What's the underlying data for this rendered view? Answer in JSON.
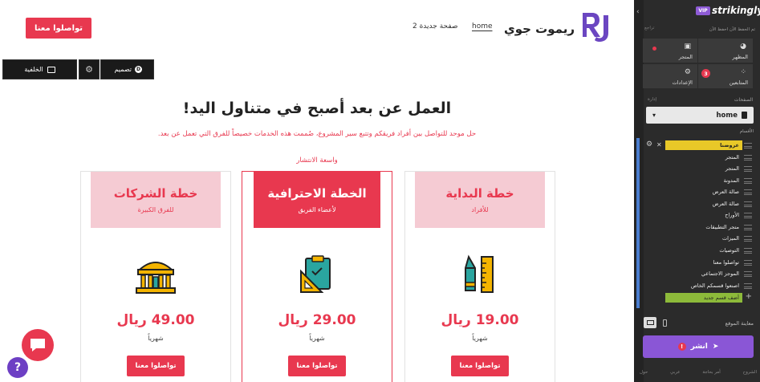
{
  "site": {
    "top_cta": "تواصلوا معنا",
    "brand": "ريموت جوي",
    "nav": {
      "home": "home",
      "new_page": "صفحة جديدة 2"
    },
    "toolbar": {
      "background": "الخلفية",
      "design": "تصميم",
      "design_mark": "D"
    },
    "headline": "العمل عن بعد أصبح في متناول اليد!",
    "subtext": "حل موحد للتواصل بين أفراد فريقكم وتتبع سير المشروع، صُممت هذه الخدمات خصيصاً للفرق التي تعمل عن بعد.",
    "popular_label": "واسعة الانتشار",
    "cards": [
      {
        "title": "خطة الشركات",
        "subtitle": "للفرق الكبيرة",
        "price": "49.00 ريال",
        "period": "شهرياً",
        "cta": "تواصلوا معنا",
        "icon": "bank-building-icon"
      },
      {
        "title": "الخطة الاحترافية",
        "subtitle": "لأعضاء الفريق",
        "price": "29.00 ريال",
        "period": "شهرياً",
        "cta": "تواصلوا معنا",
        "icon": "clipboard-ruler-icon"
      },
      {
        "title": "خطة البداية",
        "subtitle": "للأفراد",
        "price": "19.00 ريال",
        "period": "شهرياً",
        "cta": "تواصلوا معنا",
        "icon": "pen-ruler-icon"
      }
    ],
    "help_label": "?"
  },
  "editor": {
    "brand": "strikingly",
    "vip": "VIP",
    "saved_text": "تم الحفظ الآن احفظ الآن",
    "undo_text": "تراجع",
    "tiles": {
      "appearance": "المظهر",
      "store": "المتجر",
      "followers": "المتابعين",
      "settings": "الإعدادات"
    },
    "followers_count": "3",
    "pages_label": "الصفحات",
    "manage_label": "إدارة",
    "current_page": "home",
    "sections_label": "الأقسام",
    "sections": [
      "عروضنا",
      "المتجر",
      "المتجر",
      "المدونة",
      "صالة العرض",
      "صالة العرض",
      "الأوراح",
      "متجر التطبيقات",
      "الميزات",
      "التوصيات",
      "تواصلوا معنا",
      "الموجز الاجتماعي",
      "اصنعوا قسمكم الخاص"
    ],
    "add_section": "أضف قسم جديد",
    "preview_label": "معاينة الموقع",
    "publish_label": "انشر",
    "footer_links": [
      "الشروح",
      "أمر بحاجة",
      "عربي",
      "حول"
    ],
    "colors": {
      "accent": "#e8384f",
      "purple": "#8a56d6",
      "active_section": "#e8c828",
      "add_section": "#8dba3a"
    }
  }
}
